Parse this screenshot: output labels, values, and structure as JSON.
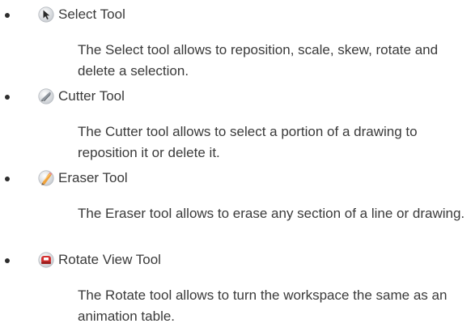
{
  "tools": [
    {
      "name": "Select Tool",
      "icon": "select-arrow-icon",
      "description": "The Select tool allows to reposition, scale, skew, rotate and delete a selection."
    },
    {
      "name": "Cutter Tool",
      "icon": "cutter-blade-icon",
      "description": "The Cutter tool allows to select a portion of a drawing to reposition it or delete it."
    },
    {
      "name": "Eraser Tool",
      "icon": "eraser-pencil-icon",
      "description": "The Eraser tool allows to erase any section of a line or drawing."
    },
    {
      "name": "Rotate View Tool",
      "icon": "rotate-view-icon",
      "description": "The Rotate tool allows to turn the workspace the same as an animation table."
    }
  ],
  "colors": {
    "text": "#3a3a3a",
    "bullet": "#2d2d2d",
    "icon_ring": "#d9d9d9",
    "rotate_accent": "#d32f2f",
    "eraser_accent": "#f0a23a"
  }
}
